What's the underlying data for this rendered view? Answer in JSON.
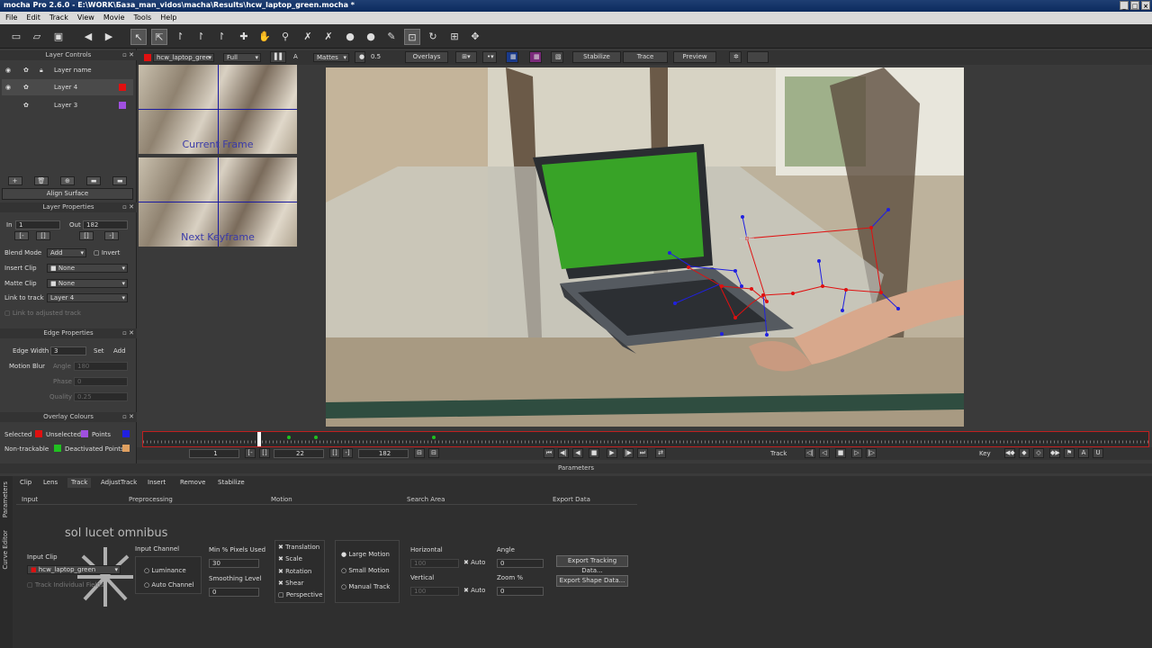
{
  "window": {
    "title": "mocha Pro 2.6.0 - E:\\WORK\\База_man_vidos\\macha\\Results\\hcw_laptop_green.mocha *",
    "min": "_",
    "max": "□",
    "close": "×"
  },
  "menu": [
    "File",
    "Edit",
    "Track",
    "View",
    "Movie",
    "Tools",
    "Help"
  ],
  "toolbar_icons": [
    "new-icon",
    "open-icon",
    "save-icon",
    "back-arrow-icon",
    "forward-arrow-icon",
    "pointer-icon",
    "select-b-icon",
    "select-i-icon",
    "select-e-icon",
    "select-a-icon",
    "add-point-icon",
    "hand-icon",
    "zoom-icon",
    "x-spline-icon",
    "x-spline-add-icon",
    "b-spline-icon",
    "b-spline-add-icon",
    "pen-icon",
    "lock-icon",
    "rotate-icon",
    "transform-icon",
    "move-icon"
  ],
  "viewbar": {
    "clip": "hcw_laptop_gree",
    "res": "Full",
    "matte_label": "A",
    "mattes": "Mattes",
    "opacity": "0.5",
    "overlays": "Overlays",
    "stabilize": "Stabilize",
    "trace": "Trace",
    "preview": "Preview"
  },
  "layer_controls": {
    "title": "Layer Controls",
    "header": "Layer name",
    "layers": [
      {
        "name": "Layer 4",
        "color": "#e01010"
      },
      {
        "name": "Layer 3",
        "color": "#a050e0"
      }
    ],
    "align": "Align Surface"
  },
  "layer_props": {
    "title": "Layer Properties",
    "in_label": "In",
    "in_val": "1",
    "out_label": "Out",
    "out_val": "182",
    "blend_label": "Blend Mode",
    "blend_val": "Add",
    "invert": "Invert",
    "insert_label": "Insert Clip",
    "insert_val": "None",
    "matte_label": "Matte Clip",
    "matte_val": "None",
    "link_label": "Link to track",
    "link_val": "Layer 4",
    "link_adj": "Link to adjusted track"
  },
  "edge_props": {
    "title": "Edge Properties",
    "width_label": "Edge Width",
    "width_val": "3",
    "set": "Set",
    "add": "Add",
    "blur_label": "Motion Blur",
    "angle_label": "Angle",
    "angle_val": "180",
    "phase_label": "Phase",
    "phase_val": "0",
    "quality_label": "Quality",
    "quality_val": "0.25"
  },
  "overlay": {
    "title": "Overlay Colours",
    "selected": "Selected",
    "unselected": "Unselected",
    "points": "Points",
    "nontrack": "Non-trackable",
    "deactivated": "Deactivated Points",
    "colors": {
      "selected": "#e01010",
      "unselected": "#a050e0",
      "points": "#2020e0",
      "nontrack": "#20c020",
      "deactivated": "#e0a060"
    }
  },
  "zoom": {
    "current": "Current Frame",
    "next": "Next Keyframe"
  },
  "transport": {
    "start": "1",
    "cur": "22",
    "end": "182",
    "track": "Track",
    "key": "Key"
  },
  "params": {
    "title": "Parameters",
    "sidetabs": [
      "Parameters",
      "Curve Editor"
    ],
    "tabs": [
      "Clip",
      "Lens",
      "Track",
      "AdjustTrack",
      "Insert",
      "Remove",
      "Stabilize"
    ],
    "sections": [
      "Input",
      "Preprocessing",
      "Motion",
      "Search Area",
      "Export Data"
    ],
    "input_clip_label": "Input Clip",
    "input_clip": "hcw_laptop_green",
    "track_ind": "Track Individual Fields",
    "channel_label": "Input Channel",
    "luminance": "Luminance",
    "autochannel": "Auto Channel",
    "minpix_label": "Min % Pixels Used",
    "minpix": "30",
    "smooth_label": "Smoothing Level",
    "smooth": "0",
    "motion": [
      "Translation",
      "Scale",
      "Rotation",
      "Shear",
      "Perspective"
    ],
    "search": [
      "Large Motion",
      "Small Motion",
      "Manual Track"
    ],
    "horiz": "Horizontal",
    "horiz_val": "100",
    "vert": "Vertical",
    "vert_val": "100",
    "auto": "Auto",
    "angle": "Angle",
    "angle_val": "0",
    "zoom": "Zoom %",
    "zoom_val": "0",
    "export_track": "Export Tracking Data...",
    "export_shape": "Export Shape Data...",
    "watermark": "sol lucet omnibus",
    "logo": "slo"
  }
}
